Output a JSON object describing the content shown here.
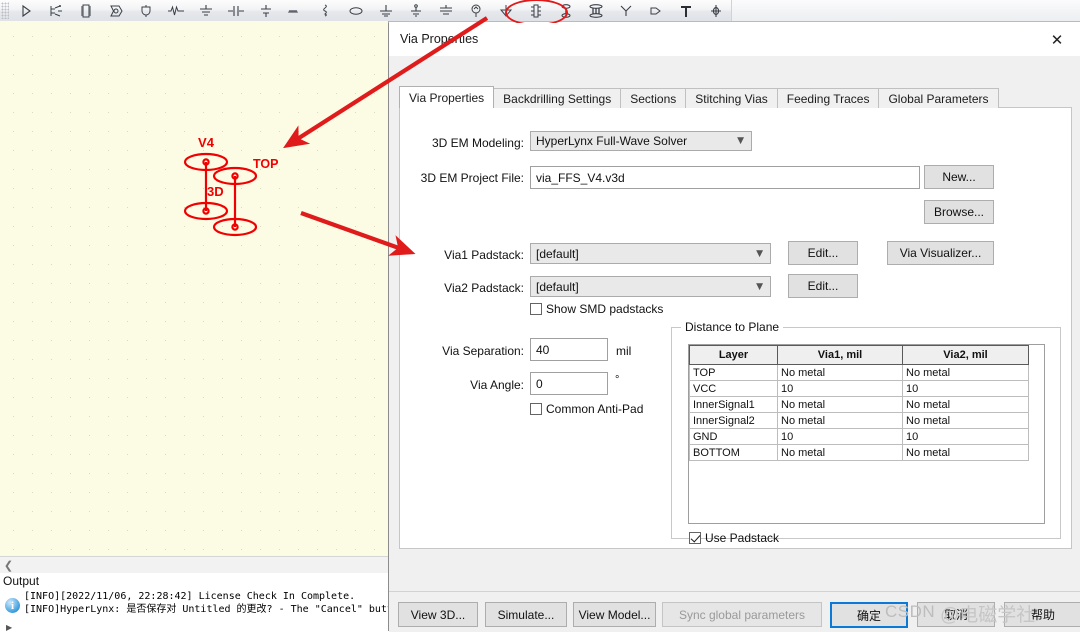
{
  "toolbar": {
    "icons": [
      "run-icon",
      "schematic-icon",
      "ic-package-icon",
      "buffer-icon",
      "probe-icon",
      "waveform-icon",
      "terminator-icon",
      "series-rl-icon",
      "capacitor-icon",
      "inductor-icon",
      "resistor-icon",
      "oscillator-icon",
      "ground-stub-icon",
      "ground-icon",
      "differential-ground-icon",
      "voltage-source-icon",
      "ground-symbol-icon",
      "ic-pin-icon",
      "via-single-icon",
      "via-array-icon",
      "connector-icon",
      "pad-icon",
      "text-icon",
      "component-icon",
      "loop-icon",
      "annotate-icon"
    ],
    "highlight_color": "#e01b1b"
  },
  "canvas": {
    "labels": {
      "via_name": "V4",
      "layer_top": "TOP",
      "model_3d": "3D"
    },
    "shape_color": "#f00000",
    "background": "#fcfce4"
  },
  "output_panel": {
    "title": "Output",
    "info_icon": "info-icon",
    "lines": [
      "[INFO][2022/11/06, 22:28:42] License Check In Complete.",
      "[INFO]HyperLynx: 是否保存对 Untitled 的更改? - The \"Cancel\" button"
    ]
  },
  "dialog": {
    "title": "Via Properties",
    "close_icon": "close-icon",
    "tabs": [
      {
        "label": "Via Properties",
        "active": true
      },
      {
        "label": "Backdrilling Settings",
        "active": false
      },
      {
        "label": "Sections",
        "active": false
      },
      {
        "label": "Stitching Vias",
        "active": false
      },
      {
        "label": "Feeding Traces",
        "active": false
      },
      {
        "label": "Global Parameters",
        "active": false
      }
    ],
    "fields": {
      "em_modeling_label": "3D EM Modeling:",
      "em_modeling_value": "HyperLynx Full-Wave Solver",
      "project_file_label": "3D EM Project File:",
      "project_file_value": "via_FFS_V4.v3d",
      "new_button": "New...",
      "browse_button": "Browse...",
      "via1_padstack_label": "Via1 Padstack:",
      "via1_padstack_value": "[default]",
      "via1_edit_button": "Edit...",
      "via_visualizer_button": "Via Visualizer...",
      "via2_padstack_label": "Via2 Padstack:",
      "via2_padstack_value": "[default]",
      "via2_edit_button": "Edit...",
      "show_smd_label": "Show SMD padstacks",
      "show_smd_checked": false,
      "via_separation_label": "Via Separation:",
      "via_separation_value": "40",
      "via_separation_unit": "mil",
      "via_angle_label": "Via Angle:",
      "via_angle_value": "0",
      "via_angle_unit": "°",
      "common_antipad_label": "Common Anti-Pad",
      "common_antipad_checked": false,
      "use_padstack_label": "Use Padstack",
      "use_padstack_checked": true
    },
    "distance_group": {
      "title": "Distance to Plane",
      "columns": [
        "Layer",
        "Via1, mil",
        "Via2, mil"
      ],
      "rows": [
        [
          "TOP",
          "No metal",
          "No metal"
        ],
        [
          "VCC",
          "10",
          "10"
        ],
        [
          "InnerSignal1",
          "No metal",
          "No metal"
        ],
        [
          "InnerSignal2",
          "No metal",
          "No metal"
        ],
        [
          "GND",
          "10",
          "10"
        ],
        [
          "BOTTOM",
          "No metal",
          "No metal"
        ]
      ]
    },
    "footer_buttons": [
      {
        "label": "View 3D...",
        "state": "normal"
      },
      {
        "label": "Simulate...",
        "state": "normal"
      },
      {
        "label": "View Model...",
        "state": "normal"
      },
      {
        "label": "Sync global parameters",
        "state": "disabled"
      },
      {
        "label": "确定",
        "state": "default"
      },
      {
        "label": "取消",
        "state": "normal"
      },
      {
        "label": "帮助",
        "state": "normal"
      }
    ]
  },
  "watermark": {
    "text_en": "CSDN",
    "text_cn": "@电磁学社"
  }
}
